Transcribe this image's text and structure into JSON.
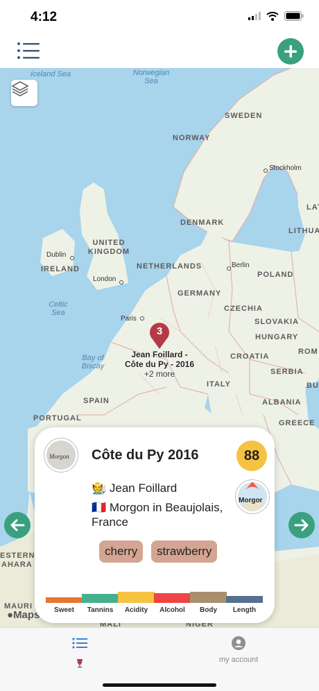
{
  "status_bar": {
    "time": "4:12"
  },
  "map": {
    "countries": [
      "SWEDEN",
      "NORWAY",
      "DENMARK",
      "UNITED KINGDOM",
      "IRELAND",
      "NETHERLANDS",
      "POLAND",
      "GERMANY",
      "CZECHIA",
      "SLOVAKIA",
      "HUNGARY",
      "CROATIA",
      "SERBIA",
      "ROM",
      "BUL",
      "ITALY",
      "SPAIN",
      "PORTUGAL",
      "ALBANIA",
      "GREECE",
      "LAT",
      "LITHUA",
      "ESTERN",
      "AHARA",
      "MAURI",
      "MALI",
      "NIGER"
    ],
    "seas": [
      "Iceland Sea",
      "Norwegian Sea",
      "Celtic Sea",
      "Bay of Biscay"
    ],
    "cities": [
      "Stockholm",
      "Dublin",
      "London",
      "Berlin",
      "Paris"
    ],
    "cluster": {
      "count": "3",
      "line1": "Jean Foillard -",
      "line2": "Côte du Py - 2016",
      "more": "+2 more"
    },
    "attribution": "Maps"
  },
  "wine": {
    "title": "Côte du Py 2016",
    "score": "88",
    "producer": "🧑‍🌾 Jean Foillard",
    "region": "🇫🇷 Morgon in Beaujolais, France",
    "bottle_label": "Morgon",
    "appellation_label": "Morgor",
    "tags": [
      "cherry",
      "strawberry"
    ],
    "profile": [
      {
        "label": "Sweet",
        "level": 0.35,
        "color": "#e8752f"
      },
      {
        "label": "Tannins",
        "level": 0.55,
        "color": "#46b08e"
      },
      {
        "label": "Acidity",
        "level": 0.65,
        "color": "#f5c242"
      },
      {
        "label": "Alcohol",
        "level": 0.6,
        "color": "#ef4444"
      },
      {
        "label": "Body",
        "level": 0.65,
        "color": "#a98f6b"
      },
      {
        "label": "Length",
        "level": 0.4,
        "color": "#56708f"
      }
    ]
  },
  "tab_bar": {
    "wines_icon": "list-icon",
    "account_label": "my account"
  },
  "colors": {
    "accent": "#3aa07f",
    "score": "#f5c242",
    "tag": "#d4a593",
    "pin": "#b63a46"
  }
}
